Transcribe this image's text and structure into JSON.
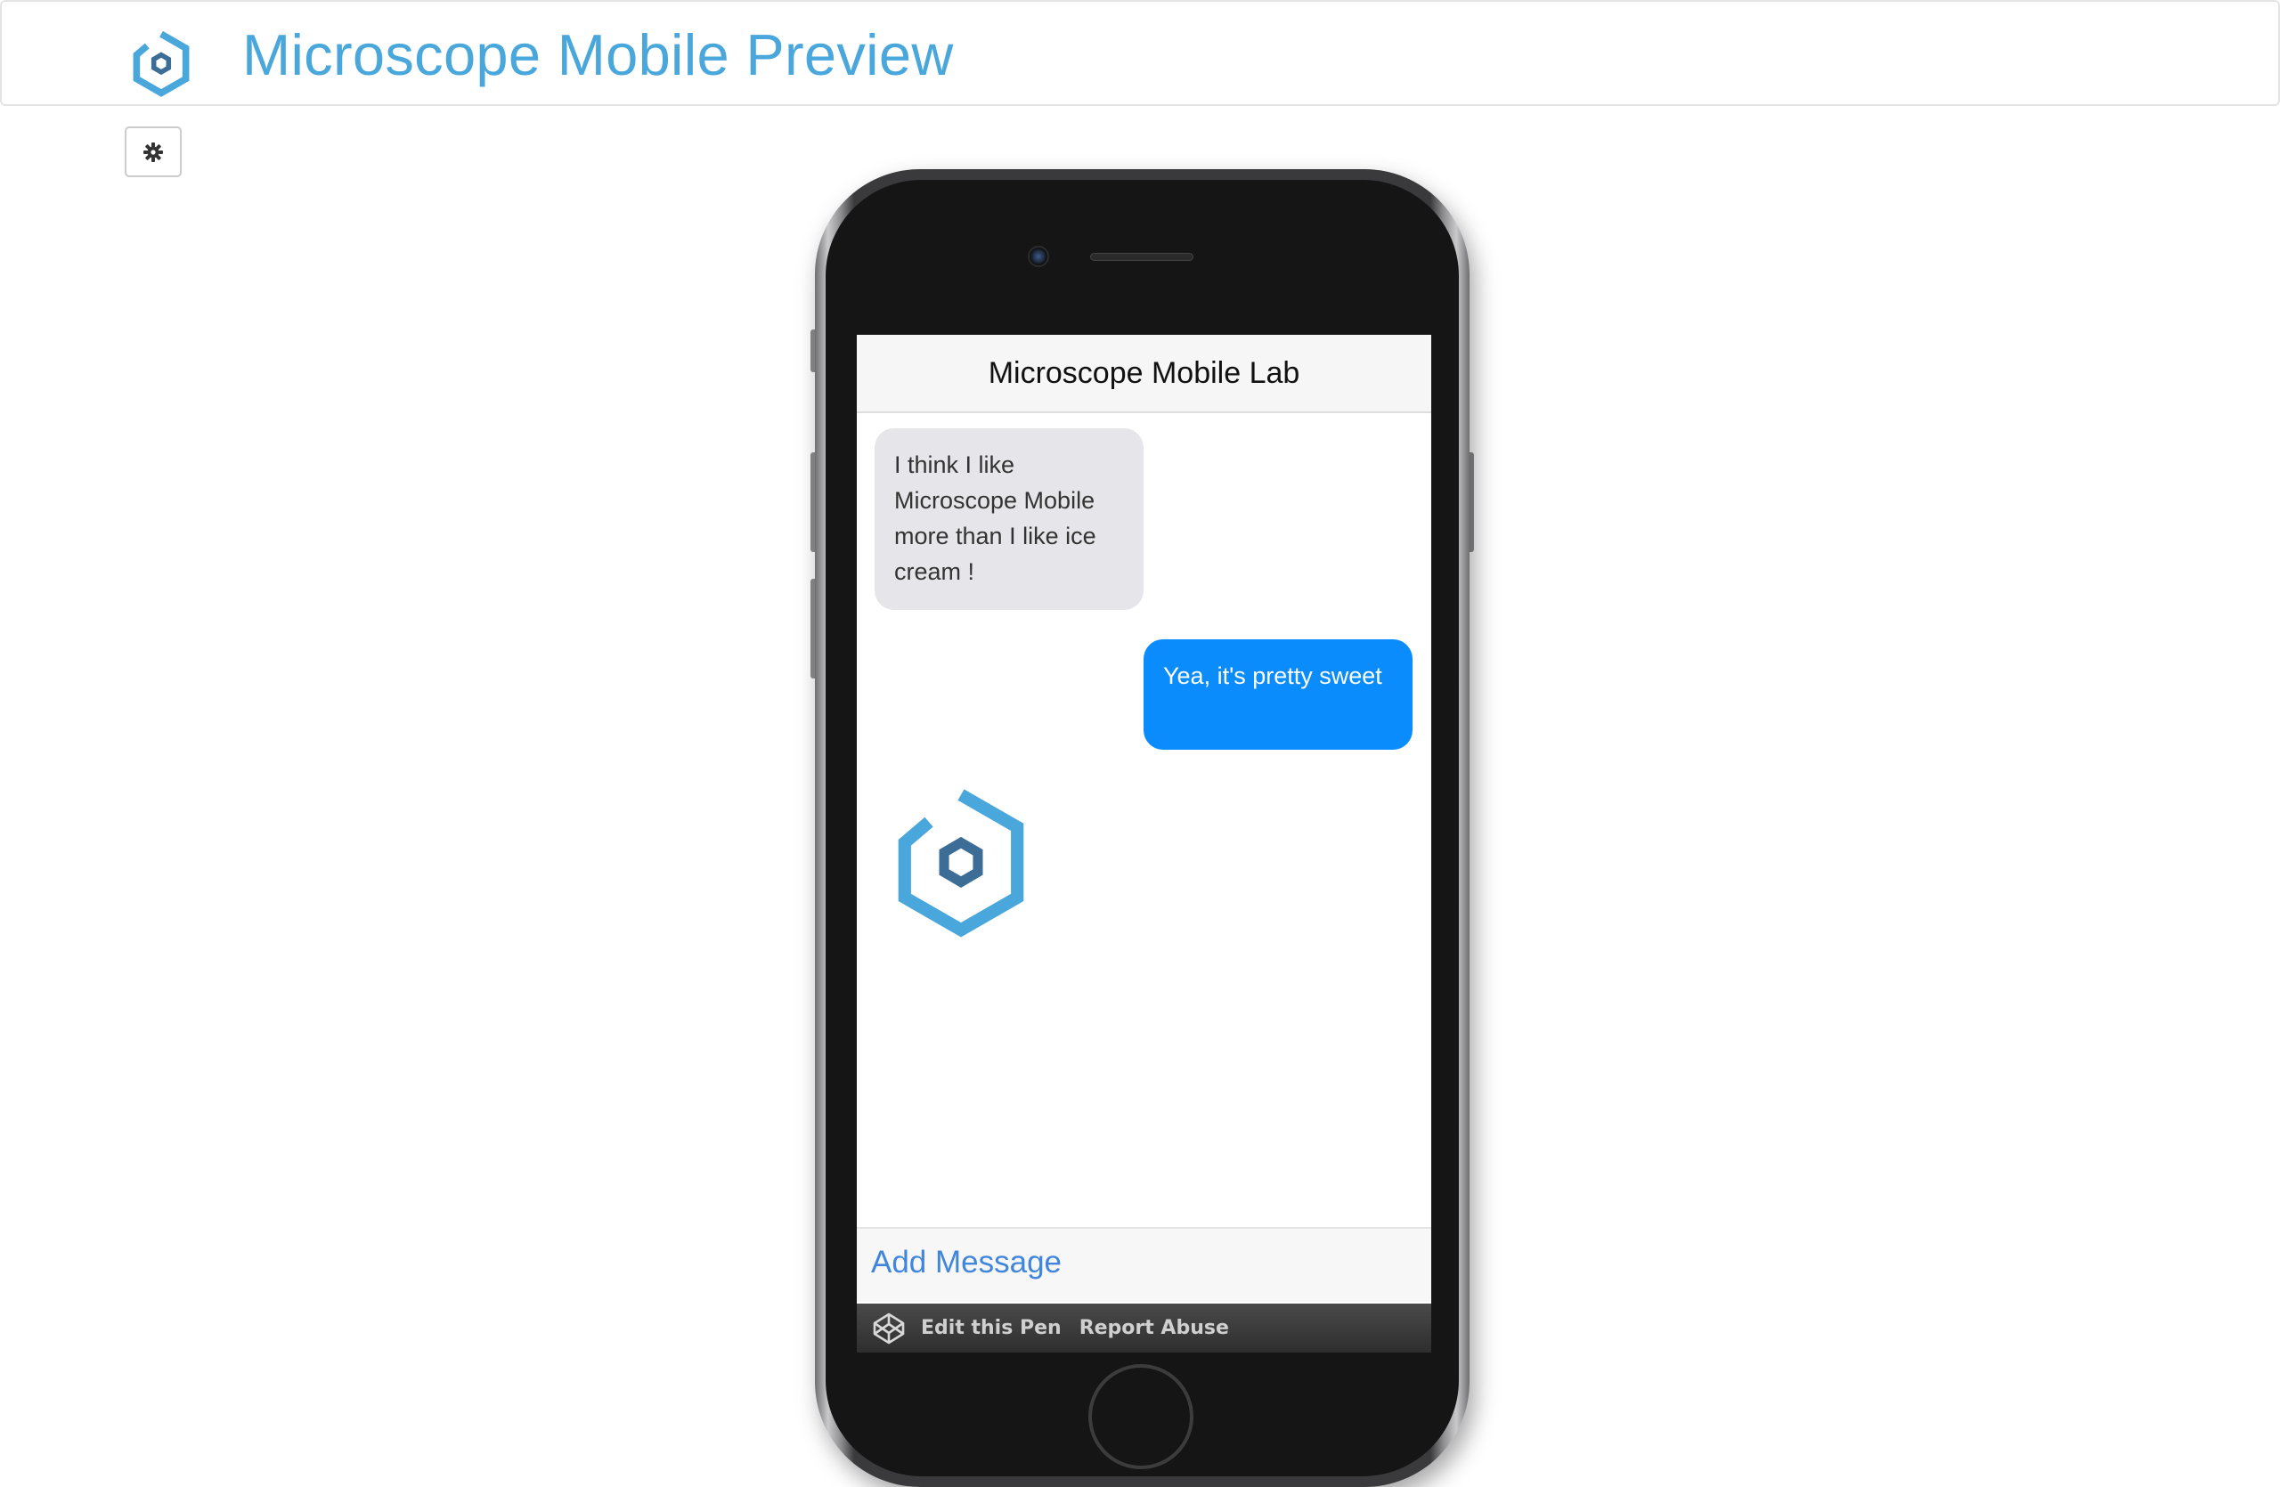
{
  "header": {
    "title": "Microscope Mobile Preview",
    "logo_icon": "microscope-hexagon-logo",
    "brand_color": "#49a7dc"
  },
  "toolbar": {
    "settings_icon": "gear-icon"
  },
  "phone": {
    "app_title": "Microscope Mobile Lab",
    "messages": [
      {
        "direction": "incoming",
        "text": "I think I like Microscope Mobile more than I like ice cream !"
      },
      {
        "direction": "outgoing",
        "text": "Yea, it's pretty sweet"
      }
    ],
    "image_message_icon": "microscope-hexagon-logo",
    "compose_placeholder": "Add Message",
    "incoming_color": "#e5e5ea",
    "outgoing_color": "#0a8cfc"
  },
  "footer_bar": {
    "logo_icon": "codepen-icon",
    "edit_label": "Edit this Pen",
    "report_label": "Report Abuse"
  }
}
